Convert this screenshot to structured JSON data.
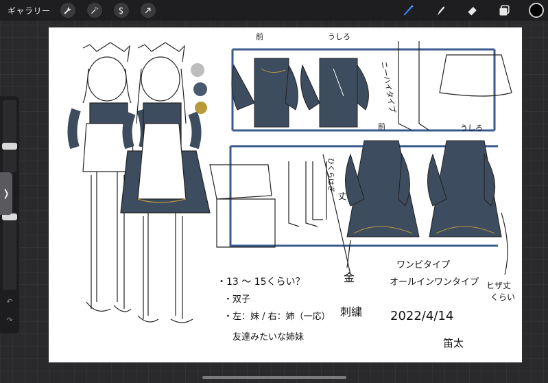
{
  "topbar": {
    "gallery_label": "ギャラリー",
    "left_tools": [
      {
        "icon": "wrench-icon"
      },
      {
        "icon": "magic-wand-icon"
      },
      {
        "icon": "selection-s-icon"
      },
      {
        "icon": "transform-arrow-icon"
      }
    ],
    "right_tools": [
      {
        "icon": "brush-icon"
      },
      {
        "icon": "smudge-icon"
      },
      {
        "icon": "eraser-icon"
      },
      {
        "icon": "layers-icon"
      }
    ],
    "current_color": "#000000"
  },
  "sidebar": {
    "toggle_glyph": "❭",
    "undo_glyph": "↶",
    "redo_glyph": "↷"
  },
  "canvas": {
    "colors": [
      "#bdbdbd",
      "#4a5a6e",
      "#b89a3a"
    ],
    "labels": {
      "front_top": "前",
      "back_top": "うしろ",
      "knee_high": "ニーハイタイプ",
      "back_apron": "うしろ",
      "front_boots": "前",
      "sleeve_note_1": "ひくらはぎ",
      "sleeve_note_2": "丈",
      "age": "・13 ～ 15くらい？",
      "twins": "・双子",
      "left_right": "・左：妹 / 右：姉（一応）",
      "friends": "友達みたいな姉妹",
      "gold_embroidery_1": "金",
      "gold_embroidery_2": "刺繍",
      "onepiece": "ワンピタイプ",
      "allinone": "オールインワンタイプ",
      "date": "2022/4/14",
      "signature": "笛太",
      "length_note_1": "ヒザ丈",
      "length_note_2": "くらい"
    }
  }
}
